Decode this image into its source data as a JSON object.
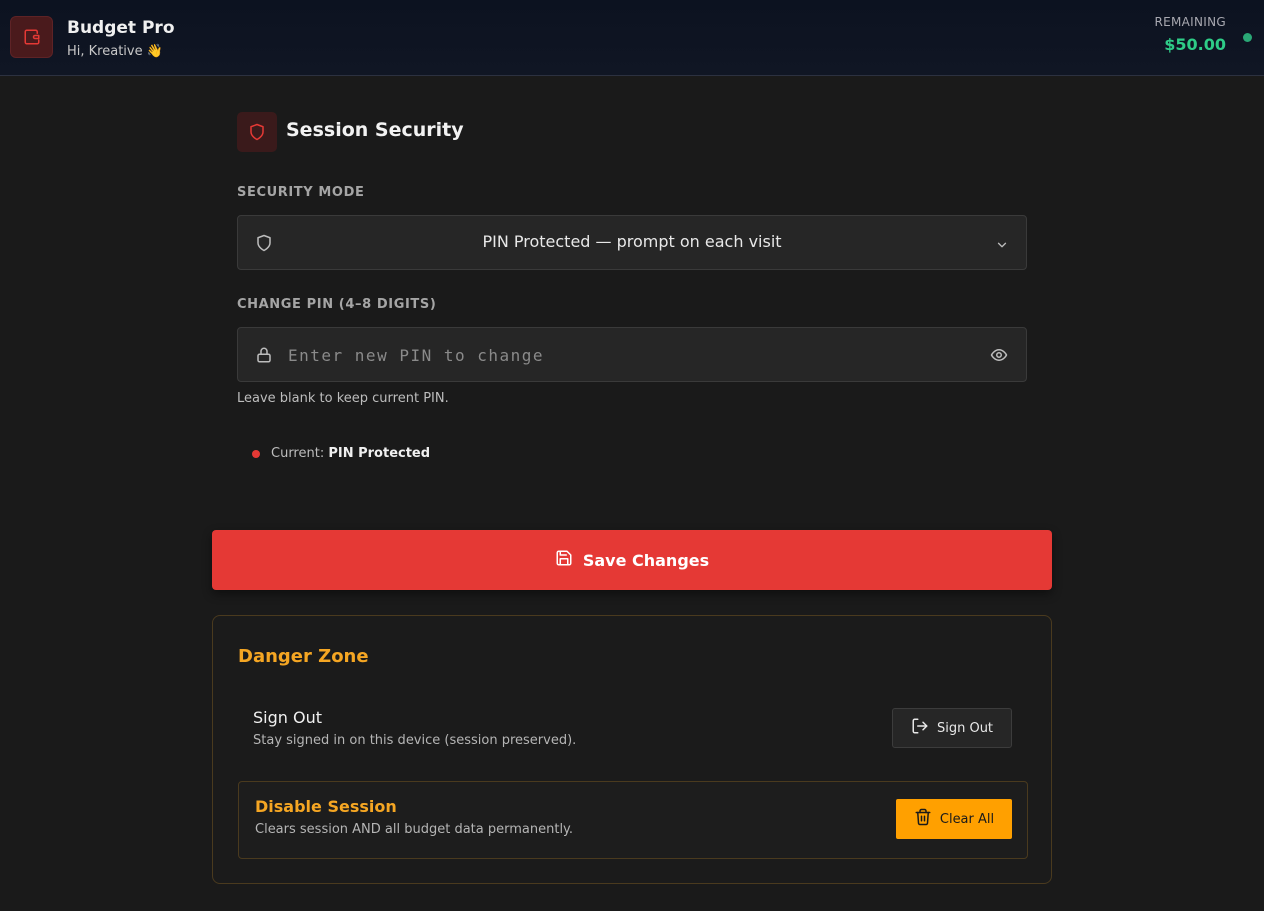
{
  "header": {
    "app_title": "Budget Pro",
    "greeting": "Hi, Kreative 👋",
    "remaining_label": "REMAINING",
    "remaining_amount": "$50.00",
    "logo_icon": "wallet-icon",
    "status_color": "#2aa876"
  },
  "security": {
    "section_title": "Session Security",
    "section_icon": "shield-icon",
    "mode_label": "SECURITY MODE",
    "mode_value": "PIN Protected — prompt on each visit",
    "pin_label": "CHANGE PIN (4–8 DIGITS)",
    "pin_placeholder": "Enter new PIN to change",
    "pin_value": "",
    "pin_hint": "Leave blank to keep current PIN.",
    "current_prefix": "Current: ",
    "current_value": "PIN Protected"
  },
  "save_button": {
    "label": "Save Changes",
    "icon": "save-icon"
  },
  "danger_zone": {
    "title": "Danger Zone",
    "sign_out": {
      "title": "Sign Out",
      "description": "Stay signed in on this device (session preserved).",
      "button_label": "Sign Out",
      "icon": "sign-out-icon"
    },
    "disable_session": {
      "title": "Disable Session",
      "description": "Clears session AND all budget data permanently.",
      "button_label": "Clear All",
      "icon": "trash-icon"
    }
  },
  "colors": {
    "accent": "#e53935",
    "warning": "#f5a623",
    "clear_button": "#ffa000",
    "success": "#2ecc87"
  }
}
